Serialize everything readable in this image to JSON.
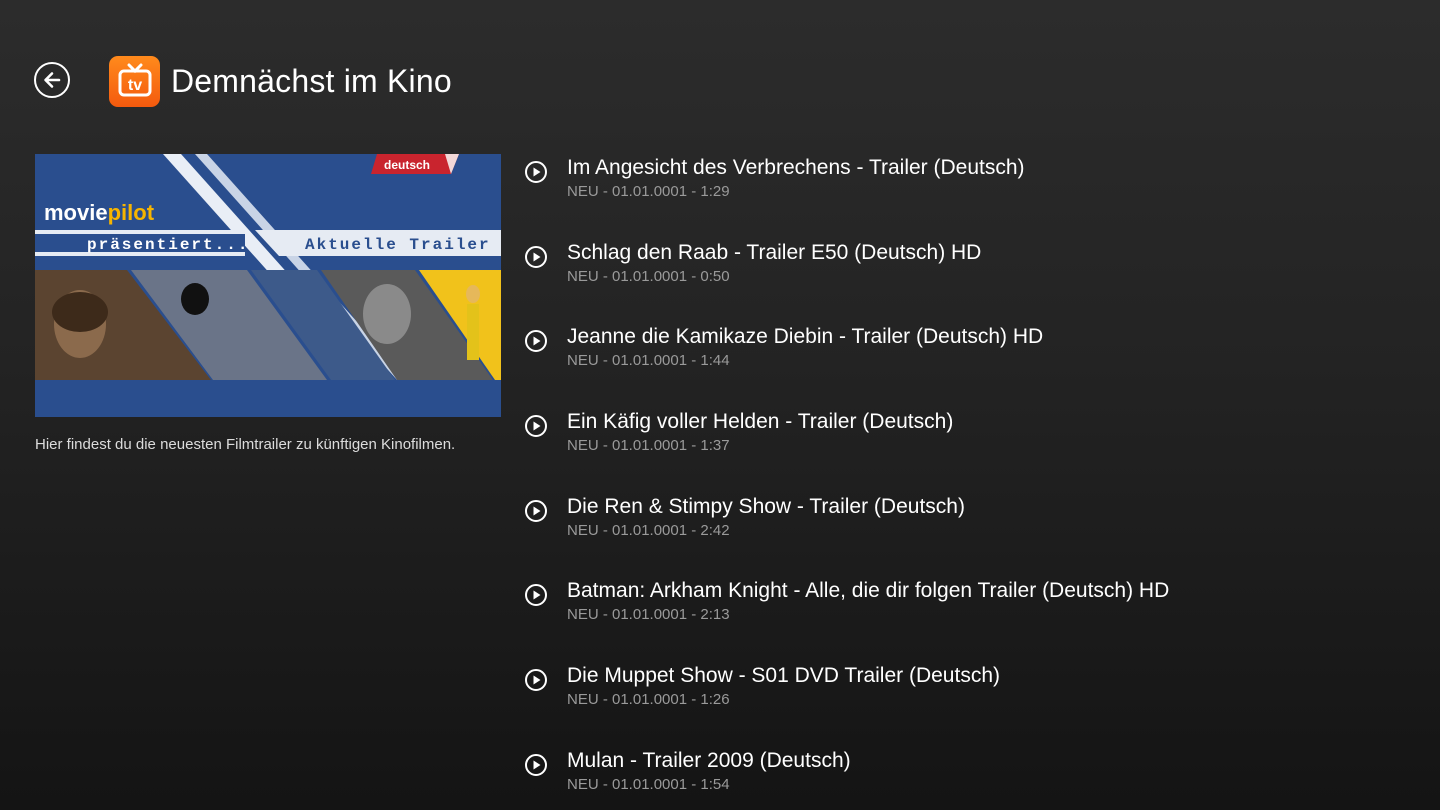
{
  "header": {
    "title": "Demnächst im Kino",
    "back_icon": "back-arrow-icon",
    "logo_icon": "tv-icon",
    "logo_text": "tv"
  },
  "banner": {
    "badge": "deutsch",
    "brand_first": "movie",
    "brand_second": "pilot",
    "presents": "präsentiert...",
    "subtitle": "Aktuelle Trailer"
  },
  "description": "Hier findest du die neuesten Filmtrailer zu künftigen Kinofilmen.",
  "trailers": [
    {
      "title": "Im Angesicht des Verbrechens - Trailer (Deutsch)",
      "meta": "NEU - 01.01.0001 - 1:29"
    },
    {
      "title": "Schlag den Raab - Trailer E50 (Deutsch) HD",
      "meta": "NEU - 01.01.0001 - 0:50"
    },
    {
      "title": "Jeanne die Kamikaze Diebin - Trailer (Deutsch) HD",
      "meta": "NEU - 01.01.0001 - 1:44"
    },
    {
      "title": "Ein Käfig voller Helden - Trailer (Deutsch)",
      "meta": "NEU - 01.01.0001 - 1:37"
    },
    {
      "title": "Die Ren & Stimpy Show - Trailer (Deutsch)",
      "meta": "NEU - 01.01.0001 - 2:42"
    },
    {
      "title": "Batman: Arkham Knight - Alle, die dir folgen Trailer (Deutsch) HD",
      "meta": "NEU - 01.01.0001 - 2:13"
    },
    {
      "title": "Die Muppet Show - S01 DVD Trailer (Deutsch)",
      "meta": "NEU - 01.01.0001 - 1:26"
    },
    {
      "title": "Mulan - Trailer 2009 (Deutsch)",
      "meta": "NEU - 01.01.0001 - 1:54"
    }
  ],
  "colors": {
    "background_top": "#2c2c2c",
    "background_bottom": "#141414",
    "logo_orange": "#f45a0e",
    "banner_blue": "#2a4e8e",
    "meta_gray": "#9a9a9a"
  }
}
